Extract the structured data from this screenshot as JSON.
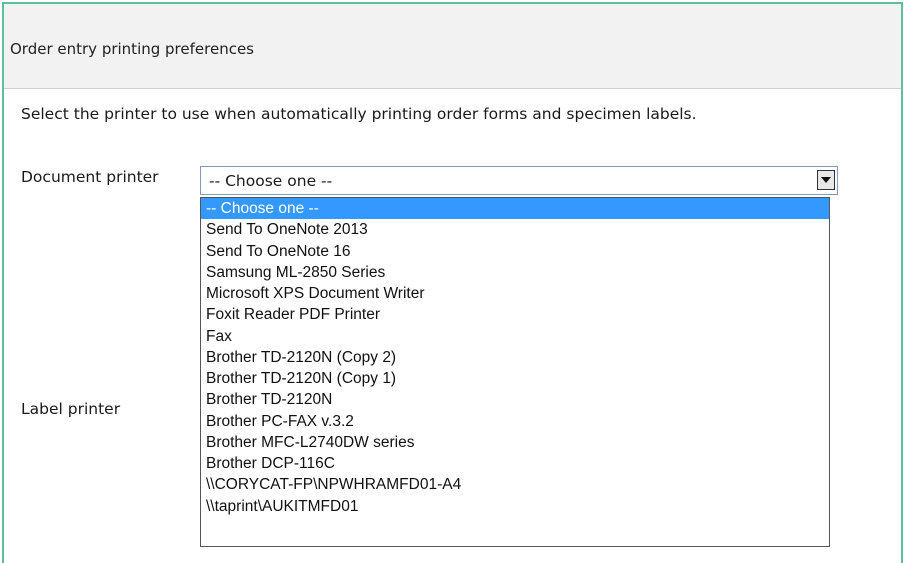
{
  "header": {
    "title": "Order entry printing preferences"
  },
  "instructions": "Select the printer to use when automatically printing order forms and specimen labels.",
  "document_printer": {
    "label": "Document printer",
    "selected": "-- Choose one --",
    "options": [
      "-- Choose one --",
      "Send To OneNote 2013",
      "Send To OneNote 16",
      "Samsung ML-2850 Series",
      "Microsoft XPS Document Writer",
      "Foxit Reader PDF Printer",
      "Fax",
      "Brother TD-2120N (Copy 2)",
      "Brother TD-2120N (Copy 1)",
      "Brother TD-2120N",
      "Brother PC-FAX v.3.2",
      "Brother MFC-L2740DW series",
      "Brother DCP-116C",
      "\\\\CORYCAT-FP\\NPWHRAMFD01-A4",
      "\\\\taprint\\AUKITMFD01"
    ]
  },
  "label_printer": {
    "label": "Label printer"
  },
  "colors": {
    "accent_border": "#5bbfa0",
    "selection": "#3399ff"
  }
}
